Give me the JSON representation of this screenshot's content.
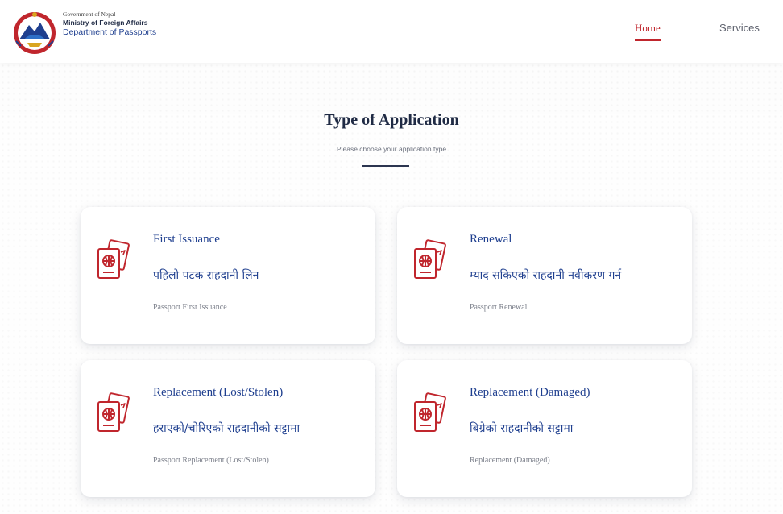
{
  "header": {
    "gov_line": "Government of Nepal",
    "ministry_line": "Ministry of Foreign Affairs",
    "department_line": "Department of Passports",
    "nav": {
      "home": "Home",
      "services": "Services"
    }
  },
  "main": {
    "title": "Type of Application",
    "subtitle": "Please choose your application type",
    "cards": [
      {
        "title_en": "First Issuance",
        "title_np": "पहिलो पटक राहदानी लिन",
        "subtitle": "Passport First Issuance",
        "icon": "passport-icon"
      },
      {
        "title_en": "Renewal",
        "title_np": "म्याद सकिएको राहदानी नवीकरण गर्न",
        "subtitle": "Passport Renewal",
        "icon": "passport-icon"
      },
      {
        "title_en": "Replacement (Lost/Stolen)",
        "title_np": "हराएको/चोरिएको राहदानीको सट्टामा",
        "subtitle": "Passport Replacement (Lost/Stolen)",
        "icon": "passport-icon"
      },
      {
        "title_en": "Replacement (Damaged)",
        "title_np": "बिग्रेको राहदानीको सट्टामा",
        "subtitle": "Replacement (Damaged)",
        "icon": "passport-icon"
      }
    ]
  },
  "colors": {
    "accent_red": "#c0262d",
    "primary_blue": "#1f3f8f",
    "heading_navy": "#1f2a44"
  }
}
